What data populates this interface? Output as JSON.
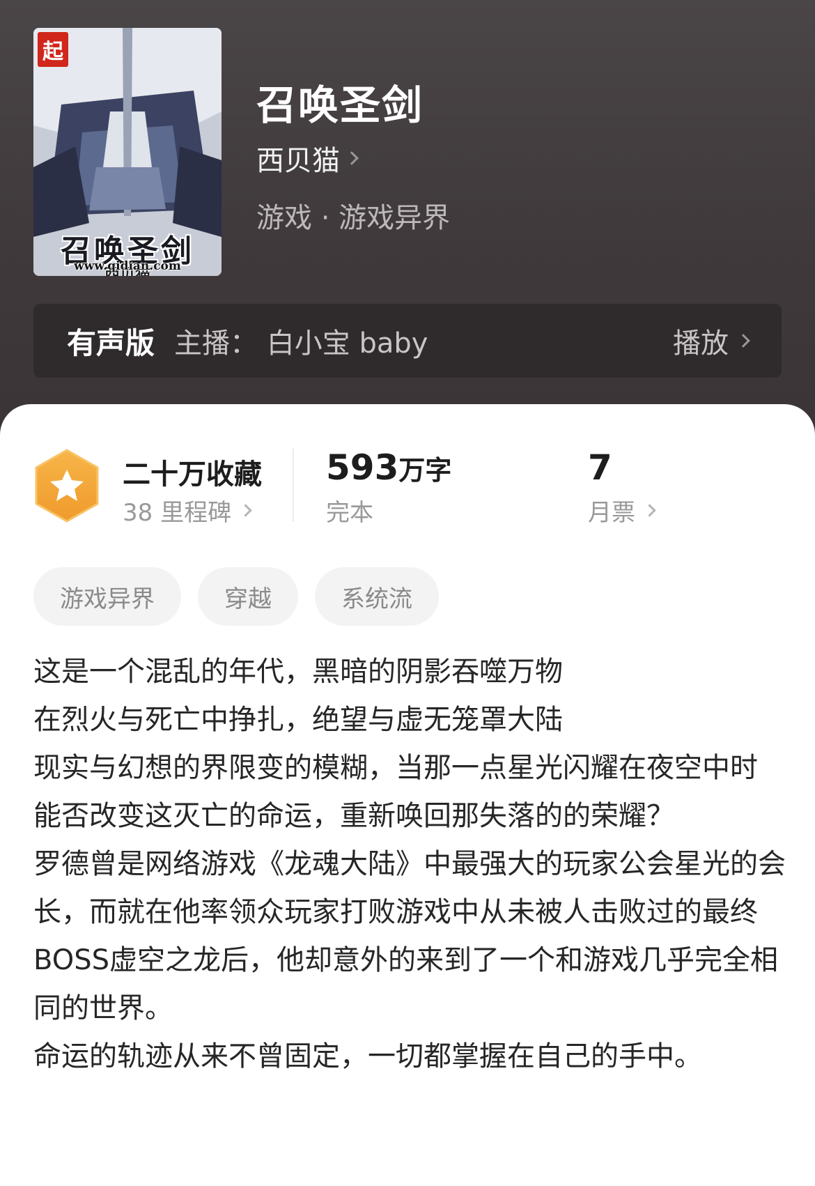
{
  "book": {
    "title": "召唤圣剑",
    "author": "西贝猫",
    "genre": "游戏 · 游戏异界",
    "cover": {
      "seal": "起",
      "title": "召唤圣剑",
      "author": "西贝猫",
      "url": "www.qidian.com"
    }
  },
  "audio": {
    "label": "有声版",
    "host": "主播： 白小宝 baby",
    "play_label": "播放"
  },
  "stats": {
    "favorites": "二十万收藏",
    "milestones": "38 里程碑",
    "word_count": "593",
    "word_unit": "万字",
    "status": "完本",
    "monthly_tickets": "7",
    "monthly_tickets_label": "月票"
  },
  "tags": [
    "游戏异界",
    "穿越",
    "系统流"
  ],
  "description": [
    "这是一个混乱的年代，黑暗的阴影吞噬万物",
    "在烈火与死亡中挣扎，绝望与虚无笼罩大陆",
    "现实与幻想的界限变的模糊，当那一点星光闪耀在夜空中时",
    "能否改变这灭亡的命运，重新唤回那失落的的荣耀？",
    "罗德曾是网络游戏《龙魂大陆》中最强大的玩家公会星光的会长，而就在他率领众玩家打败游戏中从未被人击败过的最终BOSS虚空之龙后，他却意外的来到了一个和游戏几乎完全相同的世界。",
    "命运的轨迹从来不曾固定，一切都掌握在自己的手中。"
  ],
  "colors": {
    "hero_bg": "#423c3e",
    "audio_bg": "#2f2a2c",
    "badge_orange": "#f4a93a",
    "tag_bg": "#f3f3f3"
  },
  "icons": {
    "author_chevron": "chevron-right-icon",
    "badge": "star-hexagon-icon"
  }
}
